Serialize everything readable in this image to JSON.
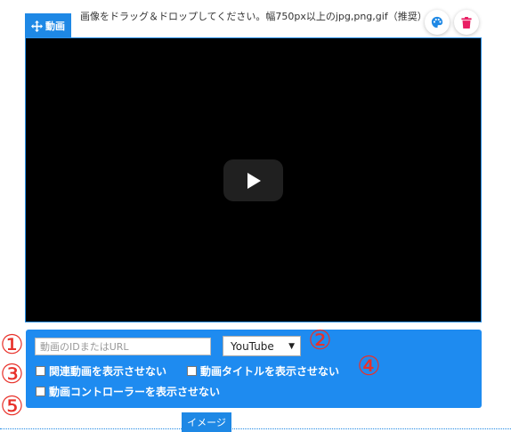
{
  "drag_tab": {
    "label": "動画",
    "icon": "move-arrows-icon"
  },
  "hint": "画像をドラッグ＆ドロップしてください。幅750px以上のjpg,png,gif（推奨）",
  "toolbar": {
    "palette_icon": "palette-icon",
    "trash_icon": "trash-icon"
  },
  "video": {
    "play_icon": "play-icon"
  },
  "form": {
    "url_placeholder": "動画のIDまたはURL",
    "url_value": "",
    "source_selected": "YouTube",
    "checkbox_related": "関連動画を表示させない",
    "checkbox_title": "動画タイトルを表示させない",
    "checkbox_controller": "動画コントローラーを表示させない"
  },
  "markers": [
    "①",
    "②",
    "③",
    "④",
    "⑤"
  ],
  "bottom_tab": "イメージ",
  "colors": {
    "accent": "#1e88e5",
    "panel": "#1e8bf0",
    "marker": "#e8312a",
    "trash": "#e91e63"
  }
}
